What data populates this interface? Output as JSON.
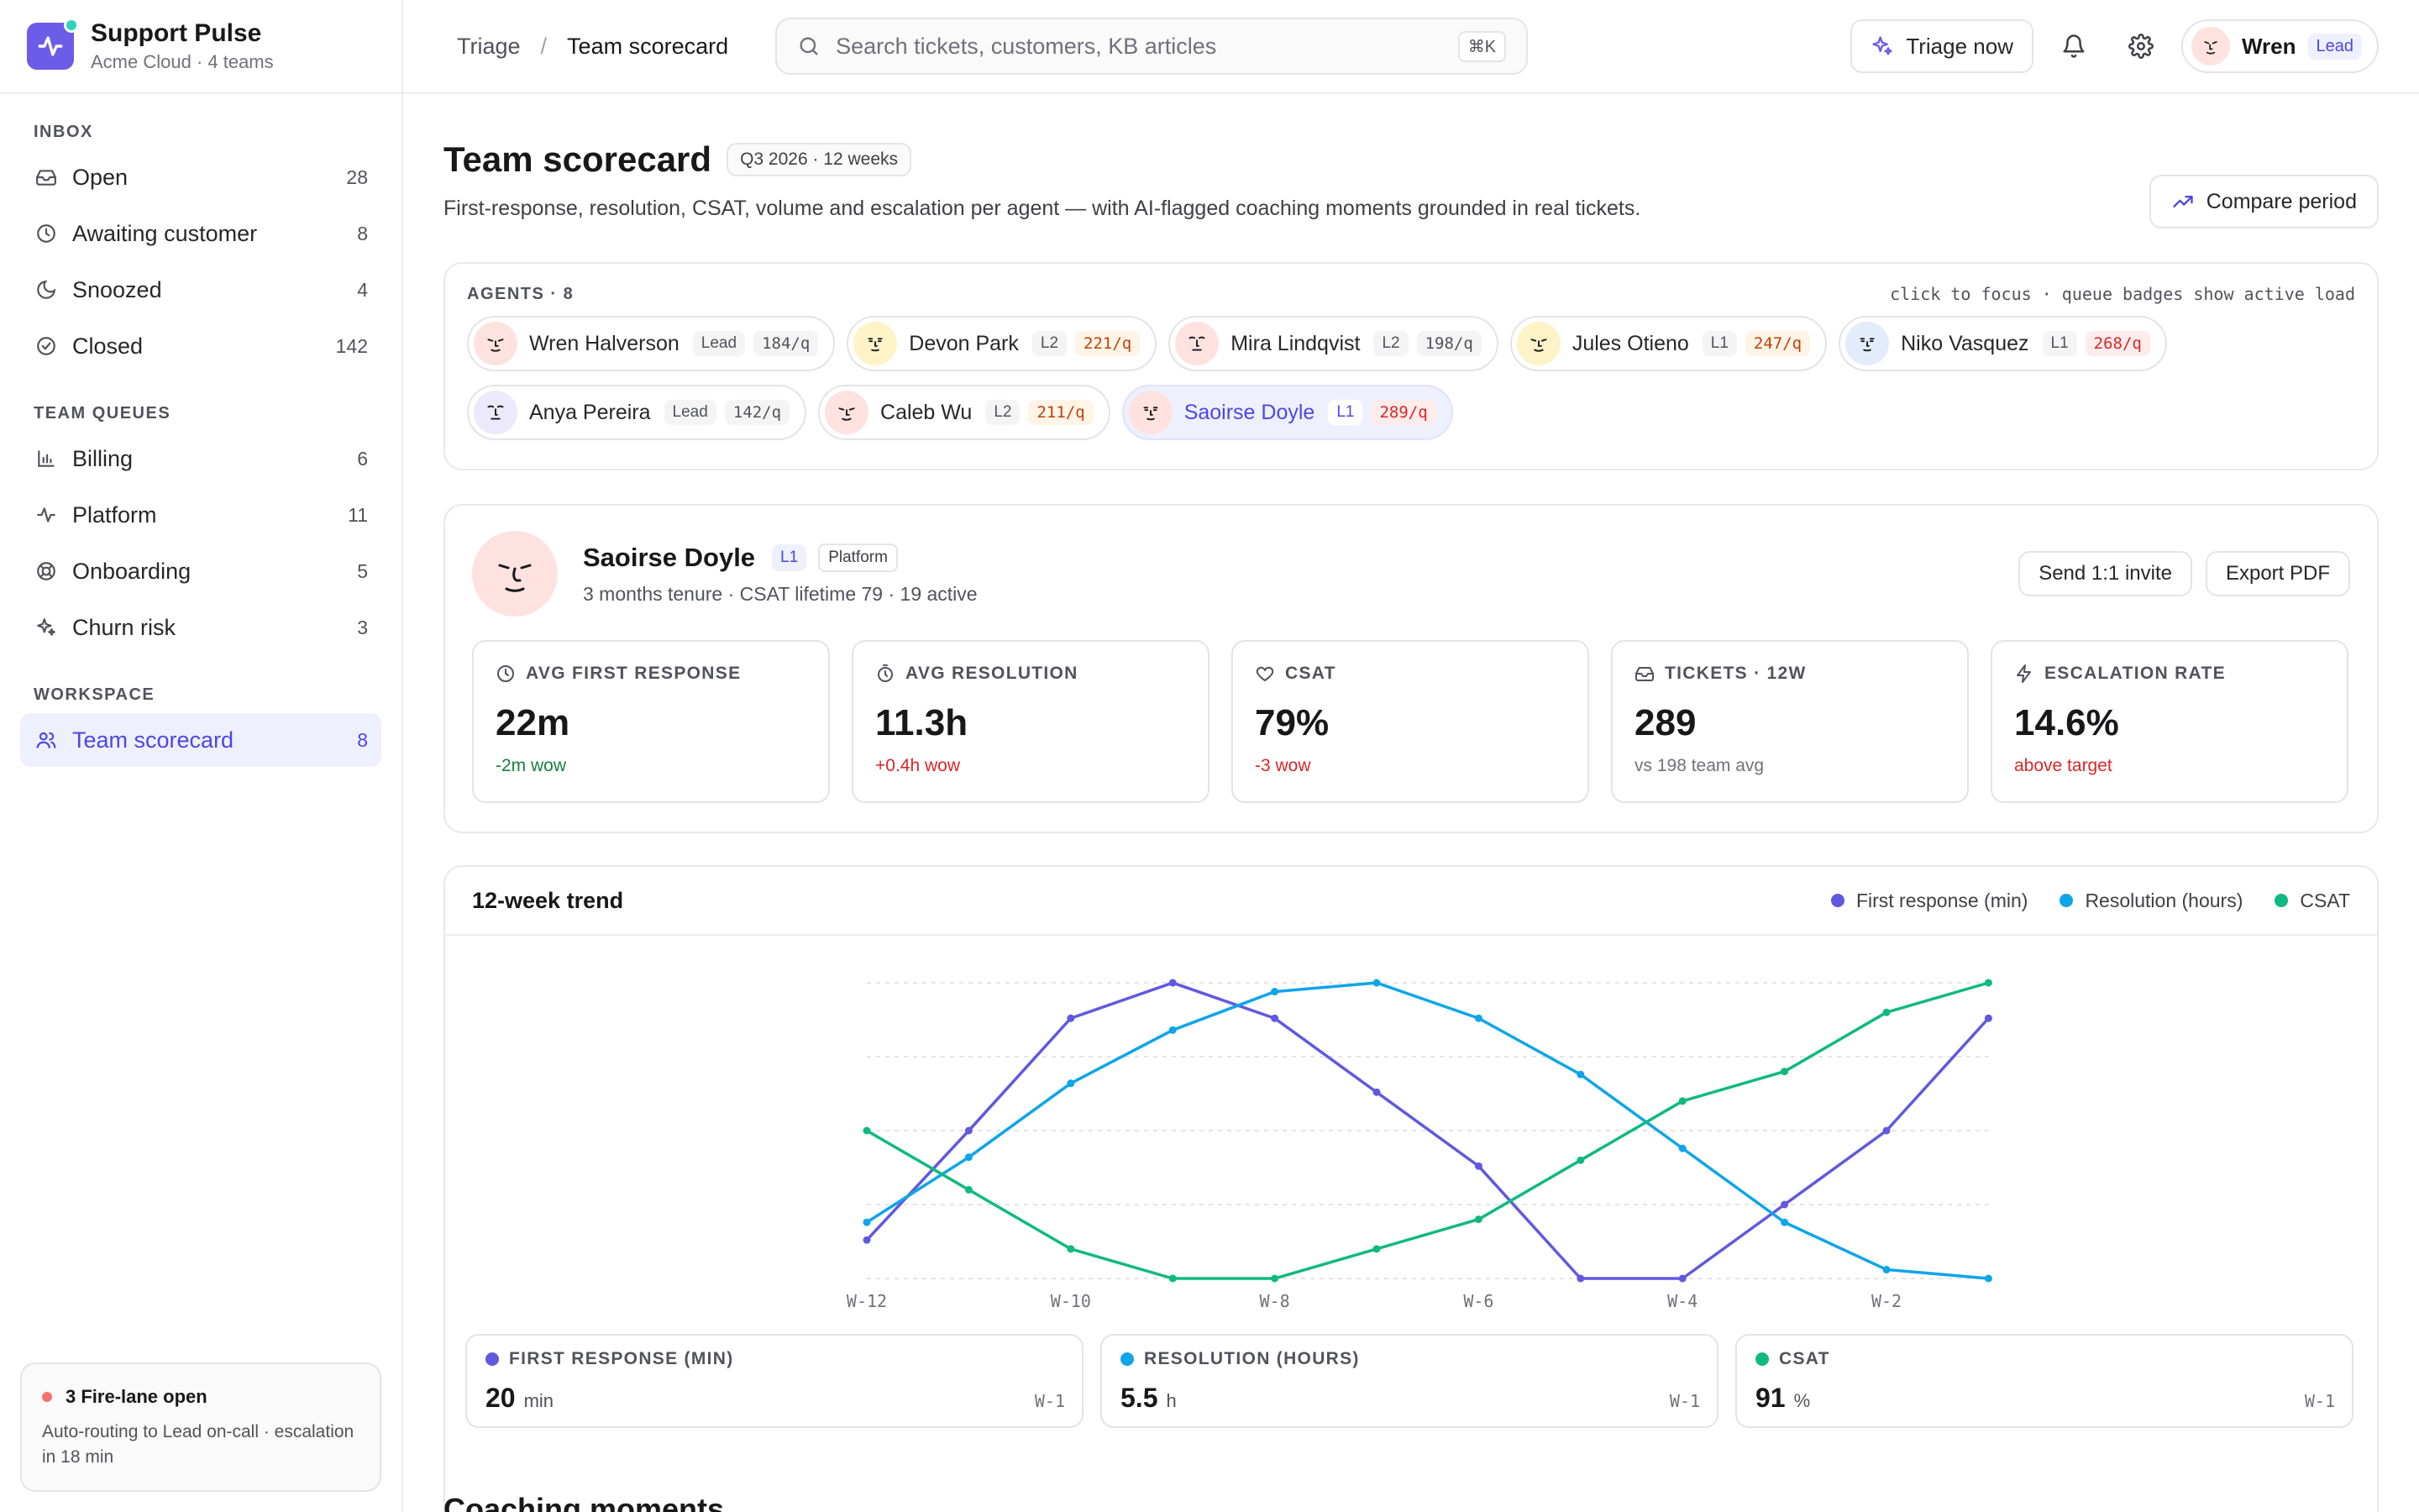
{
  "brand": {
    "name": "Support Pulse",
    "sub": "Acme Cloud · 4 teams",
    "accent": "#6d5ce8"
  },
  "sidebar": {
    "inbox_heading": "INBOX",
    "inbox": [
      {
        "label": "Open",
        "count": "28",
        "icon": "inbox-icon"
      },
      {
        "label": "Awaiting customer",
        "count": "8",
        "icon": "clock-icon"
      },
      {
        "label": "Snoozed",
        "count": "4",
        "icon": "moon-icon"
      },
      {
        "label": "Closed",
        "count": "142",
        "icon": "check-circle-icon"
      }
    ],
    "queues_heading": "TEAM QUEUES",
    "queues": [
      {
        "label": "Billing",
        "count": "6",
        "icon": "bar-chart-icon"
      },
      {
        "label": "Platform",
        "count": "11",
        "icon": "activity-icon"
      },
      {
        "label": "Onboarding",
        "count": "5",
        "icon": "lifebuoy-icon"
      },
      {
        "label": "Churn risk",
        "count": "3",
        "icon": "sparkle-icon"
      }
    ],
    "workspace_heading": "WORKSPACE",
    "workspace": [
      {
        "label": "Team scorecard",
        "count": "8",
        "icon": "users-icon",
        "active": true
      }
    ],
    "fire": {
      "title": "3 Fire-lane open",
      "desc": "Auto-routing to Lead on-call · escalation in 18 min"
    }
  },
  "topbar": {
    "crumb_parent": "Triage",
    "crumb_sep": "/",
    "crumb_current": "Team scorecard",
    "search_placeholder": "Search tickets, customers, KB articles",
    "search_kbd": "⌘K",
    "triage_label": "Triage now",
    "user_name": "Wren",
    "user_role": "Lead"
  },
  "page": {
    "title": "Team scorecard",
    "period": "Q3 2026 · 12 weeks",
    "desc": "First-response, resolution, CSAT, volume and escalation per agent — with AI-flagged coaching moments grounded in real tickets.",
    "compare_label": "Compare period"
  },
  "agents": {
    "label": "AGENTS · 8",
    "hint": "click to focus · queue badges show active load",
    "list": [
      {
        "name": "Wren Halverson",
        "level": "Lead",
        "load": "184/q",
        "load_state": "neutral",
        "avatar_bg": "#fde2e0"
      },
      {
        "name": "Devon Park",
        "level": "L2",
        "load": "221/q",
        "load_state": "warn",
        "avatar_bg": "#fdf3c7"
      },
      {
        "name": "Mira Lindqvist",
        "level": "L2",
        "load": "198/q",
        "load_state": "neutral",
        "avatar_bg": "#fde2e0"
      },
      {
        "name": "Jules Otieno",
        "level": "L1",
        "load": "247/q",
        "load_state": "warn",
        "avatar_bg": "#fdf3c7"
      },
      {
        "name": "Niko Vasquez",
        "level": "L1",
        "load": "268/q",
        "load_state": "bad",
        "avatar_bg": "#e3ecfb"
      },
      {
        "name": "Anya Pereira",
        "level": "Lead",
        "load": "142/q",
        "load_state": "neutral",
        "avatar_bg": "#ebe9fb"
      },
      {
        "name": "Caleb Wu",
        "level": "L2",
        "load": "211/q",
        "load_state": "warn",
        "avatar_bg": "#fde2e0"
      },
      {
        "name": "Saoirse Doyle",
        "level": "L1",
        "load": "289/q",
        "load_state": "bad",
        "avatar_bg": "#fde2e0",
        "selected": true
      }
    ]
  },
  "agent": {
    "name": "Saoirse Doyle",
    "level": "L1",
    "team": "Platform",
    "meta": "3 months tenure · CSAT lifetime 79 · 19 active",
    "invite_label": "Send 1:1 invite",
    "export_label": "Export PDF",
    "metrics": [
      {
        "label": "AVG FIRST RESPONSE",
        "icon": "clock-icon",
        "value": "22m",
        "sub": "-2m wow",
        "state": "good"
      },
      {
        "label": "AVG RESOLUTION",
        "icon": "timer-icon",
        "value": "11.3h",
        "sub": "+0.4h wow",
        "state": "bad"
      },
      {
        "label": "CSAT",
        "icon": "heart-icon",
        "value": "79%",
        "sub": "-3 wow",
        "state": "bad"
      },
      {
        "label": "TICKETS · 12W",
        "icon": "inbox-icon",
        "value": "289",
        "sub": "vs 198 team avg",
        "state": "neutral"
      },
      {
        "label": "ESCALATION RATE",
        "icon": "bolt-icon",
        "value": "14.6%",
        "sub": "above target",
        "state": "bad"
      }
    ]
  },
  "trend": {
    "title": "12-week trend",
    "summary": [
      {
        "label": "FIRST RESPONSE (MIN)",
        "value": "20",
        "unit": "min",
        "week": "W-1",
        "color": "#6058e0"
      },
      {
        "label": "RESOLUTION (HOURS)",
        "value": "5.5",
        "unit": "h",
        "week": "W-1",
        "color": "#0ea5e9"
      },
      {
        "label": "CSAT",
        "value": "91",
        "unit": "%",
        "week": "W-1",
        "color": "#10b981"
      }
    ]
  },
  "chart_data": {
    "type": "line",
    "x": [
      "W-12",
      "W-11",
      "W-10",
      "W-9",
      "W-8",
      "W-7",
      "W-6",
      "W-5",
      "W-4",
      "W-3",
      "W-2",
      "W-1"
    ],
    "tick_labels": [
      "W-12",
      "W-10",
      "W-8",
      "W-6",
      "W-4",
      "W-2"
    ],
    "series": [
      {
        "name": "First response (min)",
        "color": "#6058e0",
        "values": [
          0.13,
          0.5,
          0.88,
          1.0,
          0.88,
          0.63,
          0.38,
          0.0,
          0.0,
          0.25,
          0.5,
          0.88
        ]
      },
      {
        "name": "Resolution (hours)",
        "color": "#0ea5e9",
        "values": [
          0.19,
          0.41,
          0.66,
          0.84,
          0.97,
          1.0,
          0.88,
          0.69,
          0.44,
          0.19,
          0.03,
          0.0
        ]
      },
      {
        "name": "CSAT",
        "color": "#10b981",
        "values": [
          0.5,
          0.3,
          0.1,
          0.0,
          0.0,
          0.1,
          0.2,
          0.4,
          0.6,
          0.7,
          0.9,
          1.0
        ]
      }
    ],
    "ylim": [
      0,
      1
    ],
    "grid": true,
    "legend": "top-right"
  },
  "coaching": {
    "title": "Coaching moments"
  }
}
